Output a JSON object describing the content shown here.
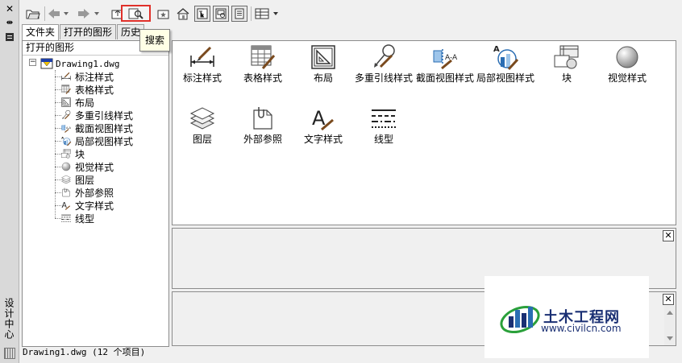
{
  "left_strip": {
    "title": "设计中心"
  },
  "toolbar": {
    "search_tooltip": "搜索"
  },
  "tabs": [
    {
      "label": "文件夹",
      "active": true
    },
    {
      "label": "打开的图形",
      "active": false
    },
    {
      "label": "历史",
      "active": false
    }
  ],
  "tree": {
    "header": "打开的图形",
    "root": "Drawing1.dwg",
    "items": [
      {
        "label": "标注样式",
        "icon": "dimstyle-icon"
      },
      {
        "label": "表格样式",
        "icon": "tablestyle-icon"
      },
      {
        "label": "布局",
        "icon": "layout-icon"
      },
      {
        "label": "多重引线样式",
        "icon": "mleaderstyle-icon"
      },
      {
        "label": "截面视图样式",
        "icon": "sectionview-icon"
      },
      {
        "label": "局部视图样式",
        "icon": "detailview-icon"
      },
      {
        "label": "块",
        "icon": "block-icon"
      },
      {
        "label": "视觉样式",
        "icon": "visualstyle-icon"
      },
      {
        "label": "图层",
        "icon": "layer-icon"
      },
      {
        "label": "外部参照",
        "icon": "xref-icon"
      },
      {
        "label": "文字样式",
        "icon": "textstyle-icon"
      },
      {
        "label": "线型",
        "icon": "linetype-icon"
      }
    ]
  },
  "content": {
    "items": [
      {
        "label": "标注样式",
        "icon": "dimstyle-icon"
      },
      {
        "label": "表格样式",
        "icon": "tablestyle-icon"
      },
      {
        "label": "布局",
        "icon": "layout-icon"
      },
      {
        "label": "多重引线样式",
        "icon": "mleaderstyle-icon"
      },
      {
        "label": "截面视图样式",
        "icon": "sectionview-icon"
      },
      {
        "label": "局部视图样式",
        "icon": "detailview-icon"
      },
      {
        "label": "块",
        "icon": "block-icon"
      },
      {
        "label": "视觉样式",
        "icon": "visualstyle-icon"
      },
      {
        "label": "图层",
        "icon": "layer-icon"
      },
      {
        "label": "外部参照",
        "icon": "xref-icon"
      },
      {
        "label": "文字样式",
        "icon": "textstyle-icon"
      },
      {
        "label": "线型",
        "icon": "linetype-icon"
      }
    ]
  },
  "status": {
    "text": "Drawing1.dwg (12 个项目)"
  },
  "watermark": {
    "title": "土木工程网",
    "url": "www.civilcn.com"
  },
  "colors": {
    "search_highlight": "#e0302a",
    "tooltip_bg": "#ffffe6",
    "watermark_text": "#1a2f73"
  }
}
